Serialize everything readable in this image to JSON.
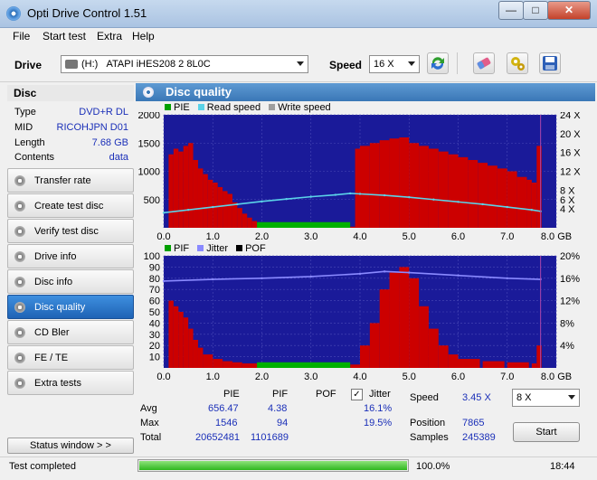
{
  "window": {
    "title": "Opti Drive Control 1.51",
    "min": "—",
    "max": "□",
    "close": "✕"
  },
  "menu": [
    "File",
    "Start test",
    "Extra",
    "Help"
  ],
  "toolbar": {
    "drive_label": "Drive",
    "drive_letter": "(H:)",
    "drive_value": "ATAPI iHES208   2 8L0C",
    "speed_label": "Speed",
    "speed_value": "16 X"
  },
  "disc": {
    "header": "Disc",
    "rows": [
      {
        "k": "Type",
        "v": "DVD+R DL"
      },
      {
        "k": "MID",
        "v": "RICOHJPN D01"
      },
      {
        "k": "Length",
        "v": "7.68 GB"
      },
      {
        "k": "Contents",
        "v": "data"
      }
    ]
  },
  "nav": [
    "Transfer rate",
    "Create test disc",
    "Verify test disc",
    "Drive info",
    "Disc info",
    "Disc quality",
    "CD Bler",
    "FE / TE",
    "Extra tests"
  ],
  "nav_active": 5,
  "status_window_button": "Status window > >",
  "panel_title": "Disc quality",
  "chart_data": [
    {
      "type": "bar",
      "title": "",
      "series": [
        {
          "name": "PIE",
          "color": "#cc0000",
          "x": [
            0.1,
            0.2,
            0.3,
            0.4,
            0.5,
            0.6,
            0.7,
            0.8,
            0.9,
            1.0,
            1.1,
            1.2,
            1.3,
            1.4,
            1.5,
            1.6,
            1.7,
            1.8,
            1.9,
            2.0,
            2.2,
            2.4,
            2.6,
            2.8,
            3.0,
            3.2,
            3.4,
            3.6,
            3.8,
            3.9,
            4.0,
            4.2,
            4.4,
            4.6,
            4.8,
            5.0,
            5.2,
            5.4,
            5.6,
            5.8,
            6.0,
            6.2,
            6.4,
            6.6,
            6.8,
            7.0,
            7.2,
            7.4,
            7.5,
            7.6
          ],
          "values": [
            1300,
            1400,
            1350,
            1450,
            1500,
            1200,
            1050,
            950,
            850,
            800,
            720,
            650,
            600,
            450,
            350,
            250,
            180,
            120,
            80,
            60,
            40,
            30,
            30,
            20,
            20,
            20,
            20,
            20,
            20,
            1400,
            1450,
            1500,
            1550,
            1580,
            1600,
            1500,
            1450,
            1400,
            1350,
            1300,
            1250,
            1200,
            1150,
            1100,
            1050,
            1000,
            900,
            850,
            800,
            1450
          ]
        },
        {
          "name": "Read speed",
          "color": "#5bd3e8",
          "x": [
            0.0,
            0.5,
            1.0,
            1.5,
            2.0,
            2.5,
            3.0,
            3.5,
            3.8,
            4.0,
            4.5,
            5.0,
            5.5,
            6.0,
            6.5,
            7.0,
            7.5,
            7.68
          ],
          "values": [
            3.2,
            3.8,
            4.4,
            5.0,
            5.6,
            6.1,
            6.6,
            7.0,
            7.3,
            7.2,
            6.9,
            6.5,
            6.0,
            5.5,
            5.0,
            4.4,
            3.8,
            3.5
          ]
        },
        {
          "name": "Write speed",
          "color": "#9e9e9e",
          "x": [],
          "values": []
        }
      ],
      "xlim": [
        0,
        8
      ],
      "ylim": [
        0,
        2000
      ],
      "y2lim": [
        0,
        24
      ],
      "x_ticks": [
        "0.0",
        "1.0",
        "2.0",
        "3.0",
        "4.0",
        "5.0",
        "6.0",
        "7.0",
        "8.0 GB"
      ],
      "y_ticks": [
        "500",
        "1000",
        "1500",
        "2000"
      ],
      "y2_ticks": [
        "4 X",
        "6 X",
        "8 X",
        "12 X",
        "16 X",
        "20 X",
        "24 X"
      ]
    },
    {
      "type": "bar",
      "title": "",
      "series": [
        {
          "name": "PIF",
          "color": "#cc0000",
          "x": [
            0.1,
            0.2,
            0.3,
            0.4,
            0.5,
            0.6,
            0.7,
            0.8,
            1.0,
            1.2,
            1.4,
            1.6,
            2.0,
            2.5,
            3.0,
            3.5,
            3.8,
            4.0,
            4.2,
            4.4,
            4.6,
            4.8,
            5.0,
            5.2,
            5.4,
            5.6,
            5.8,
            6.0,
            6.5,
            7.0,
            7.5,
            7.6
          ],
          "values": [
            60,
            55,
            50,
            45,
            35,
            25,
            18,
            12,
            8,
            6,
            5,
            4,
            3,
            3,
            3,
            3,
            3,
            20,
            40,
            70,
            85,
            90,
            80,
            55,
            35,
            20,
            12,
            8,
            6,
            5,
            4,
            20
          ]
        },
        {
          "name": "Jitter",
          "color": "#8a8aff",
          "x": [
            0.0,
            1.0,
            2.0,
            3.0,
            4.0,
            4.5,
            5.0,
            6.0,
            7.0,
            7.68
          ],
          "values": [
            15.5,
            15.8,
            16.0,
            16.3,
            16.8,
            17.2,
            17.0,
            16.5,
            16.0,
            15.8
          ]
        },
        {
          "name": "POF",
          "color": "#000000",
          "x": [],
          "values": []
        }
      ],
      "xlim": [
        0,
        8
      ],
      "ylim": [
        0,
        100
      ],
      "y2lim": [
        0,
        20
      ],
      "x_ticks": [
        "0.0",
        "1.0",
        "2.0",
        "3.0",
        "4.0",
        "5.0",
        "6.0",
        "7.0",
        "8.0 GB"
      ],
      "y_ticks": [
        "10",
        "20",
        "30",
        "40",
        "50",
        "60",
        "70",
        "80",
        "90",
        "100"
      ],
      "y2_ticks": [
        "4%",
        "8%",
        "12%",
        "16%",
        "20%"
      ]
    }
  ],
  "legend1": [
    "PIE",
    "Read speed",
    "Write speed"
  ],
  "legend2": [
    "PIF",
    "Jitter",
    "POF"
  ],
  "stats": {
    "col_pie": "PIE",
    "col_pif": "PIF",
    "col_pof": "POF",
    "col_jitter": "Jitter",
    "avg_label": "Avg",
    "max_label": "Max",
    "total_label": "Total",
    "avg_pie": "656.47",
    "avg_pif": "4.38",
    "avg_jitter": "16.1%",
    "max_pie": "1546",
    "max_pif": "94",
    "max_jitter": "19.5%",
    "total_pie": "20652481",
    "total_pif": "1101689",
    "speed_label": "Speed",
    "speed_value": "3.45 X",
    "position_label": "Position",
    "position_value": "7865",
    "samples_label": "Samples",
    "samples_value": "245389",
    "read_speed_select": "8 X",
    "start": "Start"
  },
  "statusbar": {
    "text": "Test completed",
    "progress": 1.0,
    "progress_text": "100.0%",
    "time": "18:44"
  }
}
